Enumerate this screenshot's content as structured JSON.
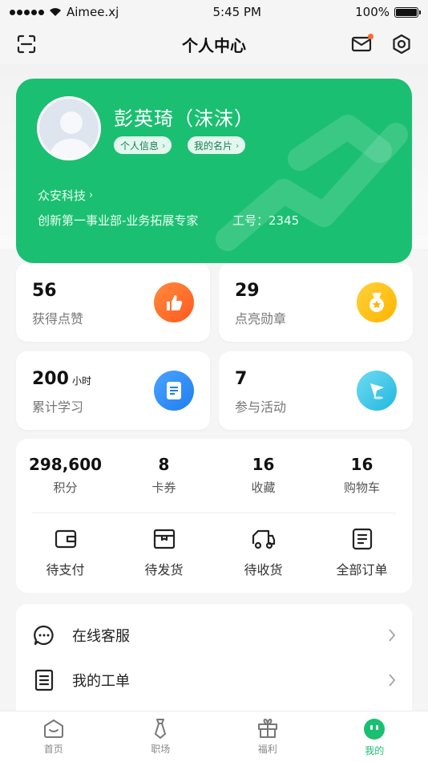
{
  "status_bar": {
    "carrier": "Aimee.xj",
    "time": "5:45 PM",
    "battery": "100%"
  },
  "nav": {
    "title": "个人中心",
    "scan_icon": "scan-icon",
    "mail_icon": "mail-icon",
    "settings_icon": "settings-icon"
  },
  "profile": {
    "name": "彭英琦（沫沫）",
    "personal_info": "个人信息",
    "business_card": "我的名片",
    "company": "众安科技",
    "department": "创新第一事业部-业务拓展专家",
    "employee_no": "工号：2345"
  },
  "stats": [
    {
      "value": "56",
      "unit": "",
      "label": "获得点赞",
      "icon": "thumbs-up-icon",
      "color": "#ff6a2b"
    },
    {
      "value": "29",
      "unit": "",
      "label": "点亮勋章",
      "icon": "medal-icon",
      "color": "#ffc21a"
    },
    {
      "value": "200",
      "unit": "小时",
      "label": "累计学习",
      "icon": "document-icon",
      "color": "#2f8cf5"
    },
    {
      "value": "7",
      "unit": "",
      "label": "参与活动",
      "icon": "flag-icon",
      "color": "#38c4e6"
    }
  ],
  "account": [
    {
      "value": "298,600",
      "label": "积分"
    },
    {
      "value": "8",
      "label": "卡券"
    },
    {
      "value": "16",
      "label": "收藏"
    },
    {
      "value": "16",
      "label": "购物车"
    }
  ],
  "orders": [
    {
      "label": "待支付",
      "icon": "wallet-icon"
    },
    {
      "label": "待发货",
      "icon": "box-icon"
    },
    {
      "label": "待收货",
      "icon": "truck-icon"
    },
    {
      "label": "全部订单",
      "icon": "list-icon"
    }
  ],
  "services": [
    {
      "label": "在线客服",
      "icon": "chat-icon"
    },
    {
      "label": "我的工单",
      "icon": "ticket-icon"
    }
  ],
  "tabs": [
    {
      "label": "首页",
      "icon": "home-icon"
    },
    {
      "label": "职场",
      "icon": "tie-icon"
    },
    {
      "label": "福利",
      "icon": "gift-icon"
    },
    {
      "label": "我的",
      "icon": "profile-face-icon",
      "active": true
    }
  ],
  "colors": {
    "brand_green": "#1bbf72",
    "notification_dot": "#ff6a2b"
  }
}
